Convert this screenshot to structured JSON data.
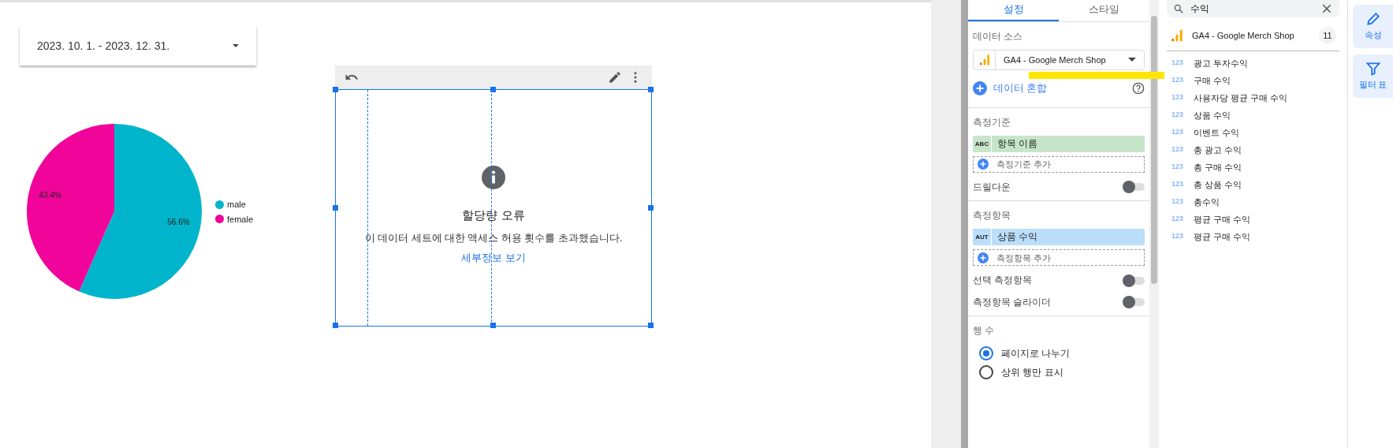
{
  "report": {
    "date_range": {
      "label": "2023. 10. 1. - 2023. 12. 31."
    },
    "pie": {
      "chart_data": {
        "type": "pie",
        "categories": [
          "male",
          "female"
        ],
        "series": [
          {
            "values": [
              56.6,
              43.4
            ]
          }
        ],
        "value_labels": [
          "56.6%",
          "43.4%"
        ]
      },
      "legend": [
        {
          "color": "#00b5cb"
        },
        {
          "color": "#f0049a"
        }
      ]
    },
    "error_widget": {
      "title": "할당량 오류",
      "message": "이 데이터 세트에 대한 액세스 허용 횟수를 초과했습니다.",
      "link": "세부정보 보기"
    }
  },
  "properties_panel": {
    "tabs": [
      {
        "label": "설정",
        "selected": true
      },
      {
        "label": "스타일",
        "selected": false
      }
    ],
    "data_source": {
      "heading": "데이터 소스",
      "name": "GA4 - Google Merch Shop",
      "blend": "데이터 혼합"
    },
    "sections": [
      {
        "heading": "측정기준",
        "fields": [
          {
            "type": "ABC",
            "name": "항목 이름",
            "kind": "dimension"
          }
        ],
        "add": "측정기준 추가",
        "toggles": [
          {
            "label": "드릴다운",
            "on": false
          }
        ]
      },
      {
        "heading": "측정항목",
        "fields": [
          {
            "type": "AUT",
            "name": "상품 수익",
            "kind": "metric"
          }
        ],
        "add": "측정항목 추가",
        "toggles": [
          {
            "label": "선택 측정항목",
            "on": false
          },
          {
            "label": "측정항목 슬라이더",
            "on": false
          }
        ]
      }
    ],
    "rows": {
      "heading": "행 수",
      "options": [
        {
          "label": "페이지로 나누기",
          "selected": true
        },
        {
          "label": "상위 행만 표시",
          "selected": false
        }
      ]
    }
  },
  "field_picker": {
    "search": {
      "value": "수익"
    },
    "source": {
      "name": "GA4 - Google Merch Shop",
      "count": "11"
    },
    "fields": [
      {
        "type": "123",
        "name": "광고 투자수익"
      },
      {
        "type": "123",
        "name": "구매 수익"
      },
      {
        "type": "123",
        "name": "사용자당 평균 구매 수익"
      },
      {
        "type": "123",
        "name": "상품 수익"
      },
      {
        "type": "123",
        "name": "이벤트 수익"
      },
      {
        "type": "123",
        "name": "총 광고 수익"
      },
      {
        "type": "123",
        "name": "총 구매 수익"
      },
      {
        "type": "123",
        "name": "총 상품 수익"
      },
      {
        "type": "123",
        "name": "총수익"
      },
      {
        "type": "123",
        "name": "평균 구매 수익"
      },
      {
        "type": "123",
        "name": "평균 구매 수익"
      }
    ]
  },
  "rail": [
    {
      "label": "속성",
      "kind": "edit"
    },
    {
      "label": "필터 표",
      "kind": "filter"
    }
  ]
}
